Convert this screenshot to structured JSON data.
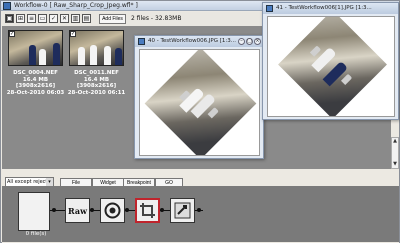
{
  "main_window": {
    "title": "Workflow-0 [ Raw_Sharp_Crop_Jpeg.wfl* ]",
    "add_files_label": "Add Files",
    "files_count": "2 files - 32.83MB"
  },
  "thumbnails": [
    {
      "name": "DSC_0004.NEF",
      "info": "16.4 MB [3908x2616]",
      "date": "28-Oct-2010 06:03",
      "checked": true
    },
    {
      "name": "DSC_0011.NEF",
      "info": "16.4 MB [3908x2616]",
      "date": "28-Oct-2010 06:11",
      "checked": true
    }
  ],
  "controls": {
    "filter_value": "All except rejects",
    "buttons": [
      "File",
      "Widget",
      "Breakpoint",
      "GO"
    ]
  },
  "pipeline": {
    "sink_label": "0 file(s)",
    "nodes": [
      {
        "label": "Raw",
        "icon": "raw-icon"
      },
      {
        "label": "",
        "icon": "sharpen-icon"
      },
      {
        "label": "",
        "icon": "crop-icon"
      },
      {
        "label": "",
        "icon": "jpeg-save-icon"
      }
    ]
  },
  "image_windows": [
    {
      "title": "40 - TestWorkflow006.JPG [1:3..."
    },
    {
      "title": "41 - TestWorkflow006[1].JPG [1:3..."
    }
  ]
}
